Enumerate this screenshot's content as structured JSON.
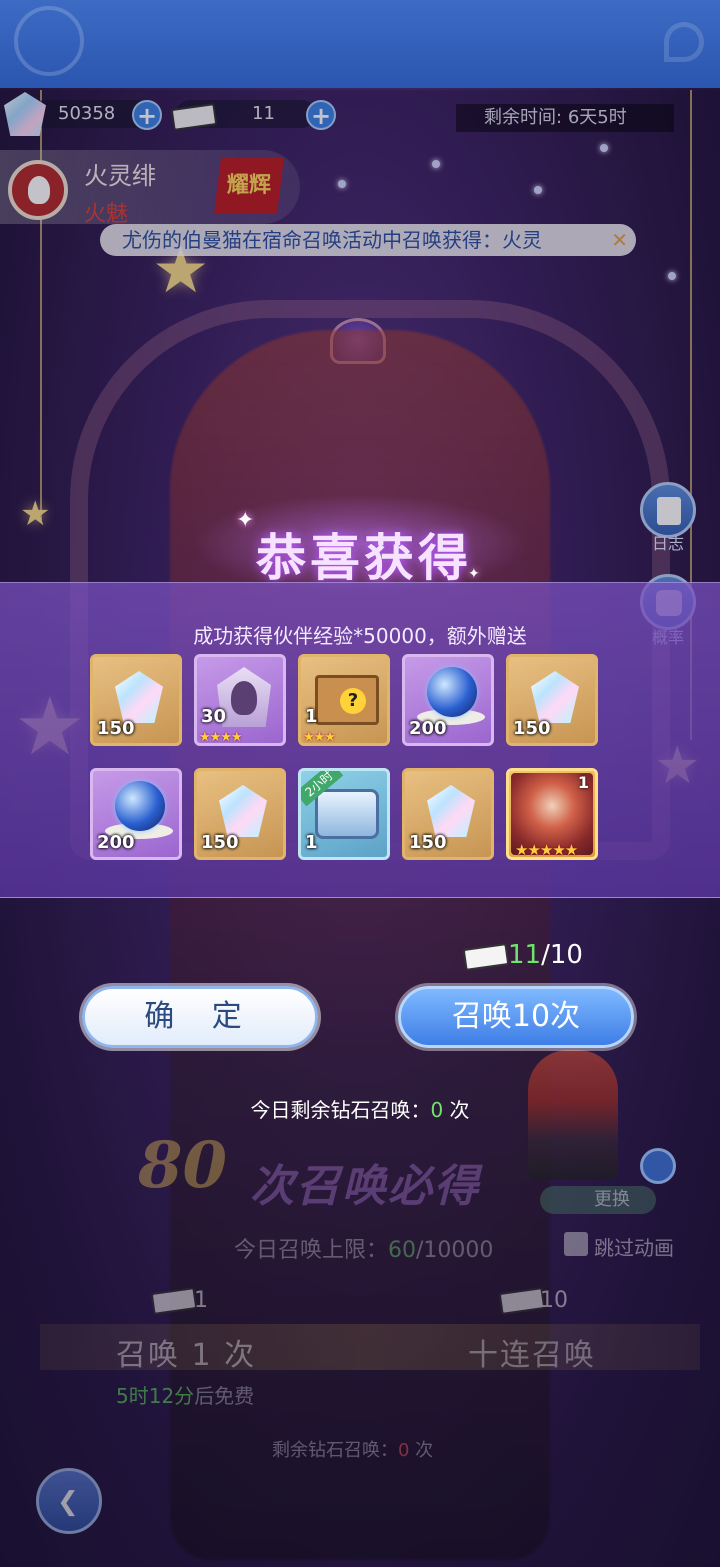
{
  "header": {
    "gems": "50358",
    "tickets": "11",
    "timer_label": "剩余时间:",
    "timer_value": "6天5时"
  },
  "character": {
    "name": "火灵绯",
    "subtitle": "火魅",
    "badge": "耀辉"
  },
  "marquee": "尤伤的伯曼猫在宿命召唤活动中召唤获得：火灵",
  "side_buttons": [
    {
      "label": "日志",
      "icon": "log-icon"
    },
    {
      "label": "概率",
      "icon": "dice-icon"
    }
  ],
  "reward_dialog": {
    "title": "恭喜获得",
    "message": "成功获得伙伴经验*50000，额外赠送",
    "items": [
      {
        "name": "crystal",
        "qty": "150",
        "frame": "gold",
        "stars": ""
      },
      {
        "name": "hooded-figure-shard",
        "qty": "30",
        "frame": "purple",
        "stars": "★★★★"
      },
      {
        "name": "mystery-chest",
        "qty": "1",
        "frame": "gold",
        "stars": "★★★"
      },
      {
        "name": "blue-orb",
        "qty": "200",
        "frame": "purple",
        "stars": ""
      },
      {
        "name": "crystal",
        "qty": "150",
        "frame": "gold",
        "stars": ""
      },
      {
        "name": "blue-orb",
        "qty": "200",
        "frame": "purple",
        "stars": ""
      },
      {
        "name": "crystal",
        "qty": "150",
        "frame": "gold",
        "stars": ""
      },
      {
        "name": "timed-chest",
        "qty": "1",
        "frame": "blue",
        "stars": "",
        "ribbon": "2小时"
      },
      {
        "name": "crystal",
        "qty": "150",
        "frame": "gold",
        "stars": ""
      },
      {
        "name": "character-portrait",
        "qty": "1",
        "frame": "orange",
        "stars": "★★★★★"
      }
    ],
    "ticket_have": "11",
    "ticket_need": "/10",
    "confirm_label": "确 定",
    "summon_label": "召唤10次"
  },
  "today_diamond": {
    "label": "今日剩余钻石召唤：",
    "value": "0",
    "unit": " 次"
  },
  "pity": {
    "number": "80",
    "text": "次召唤必得"
  },
  "change_label": "更换",
  "limit": {
    "label": "今日召唤上限：",
    "used": "60",
    "max": "/10000"
  },
  "skip_label": "跳过动画",
  "summon_once": {
    "cost": "1",
    "label": "召唤 1 次",
    "free_time": "5时12分",
    "free_suffix": "后免费"
  },
  "summon_ten": {
    "cost": "10",
    "label": "十连召唤"
  },
  "remaining_diamond": {
    "label": "剩余钻石召唤：",
    "value": "0",
    "unit": " 次"
  }
}
